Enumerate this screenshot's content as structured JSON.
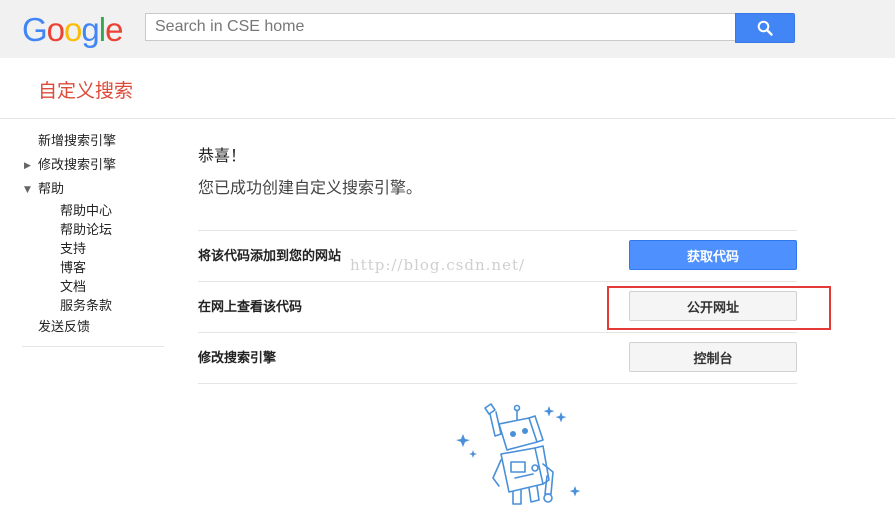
{
  "header": {
    "logo_letters": [
      {
        "char": "G",
        "color": "#4285f4"
      },
      {
        "char": "o",
        "color": "#ea4335"
      },
      {
        "char": "o",
        "color": "#fbbc05"
      },
      {
        "char": "g",
        "color": "#4285f4"
      },
      {
        "char": "l",
        "color": "#34a853"
      },
      {
        "char": "e",
        "color": "#ea4335"
      }
    ],
    "search_placeholder": "Search in CSE home",
    "search_icon": "search-icon"
  },
  "subheader": {
    "title": "自定义搜索"
  },
  "sidebar": {
    "items": [
      {
        "label": "新增搜索引擎"
      },
      {
        "label": "修改搜索引擎",
        "arrow": "▶"
      },
      {
        "label": "帮助",
        "arrow": "▼"
      }
    ],
    "help_children": [
      "帮助中心",
      "帮助论坛",
      "支持",
      "博客",
      "文档",
      "服务条款"
    ],
    "feedback": "发送反馈"
  },
  "main": {
    "congrats": "恭喜！",
    "success_message": "您已成功创建自定义搜索引擎。",
    "actions": [
      {
        "label": "将该代码添加到您的网站",
        "button": "获取代码"
      },
      {
        "label": "在网上查看该代码",
        "button": "公开网址"
      },
      {
        "label": "修改搜索引擎",
        "button": "控制台"
      }
    ]
  },
  "watermark": "http://blog.csdn.net/",
  "colors": {
    "accent": "#4285f4",
    "title_red": "#dd4b39",
    "highlight": "#e53935"
  }
}
